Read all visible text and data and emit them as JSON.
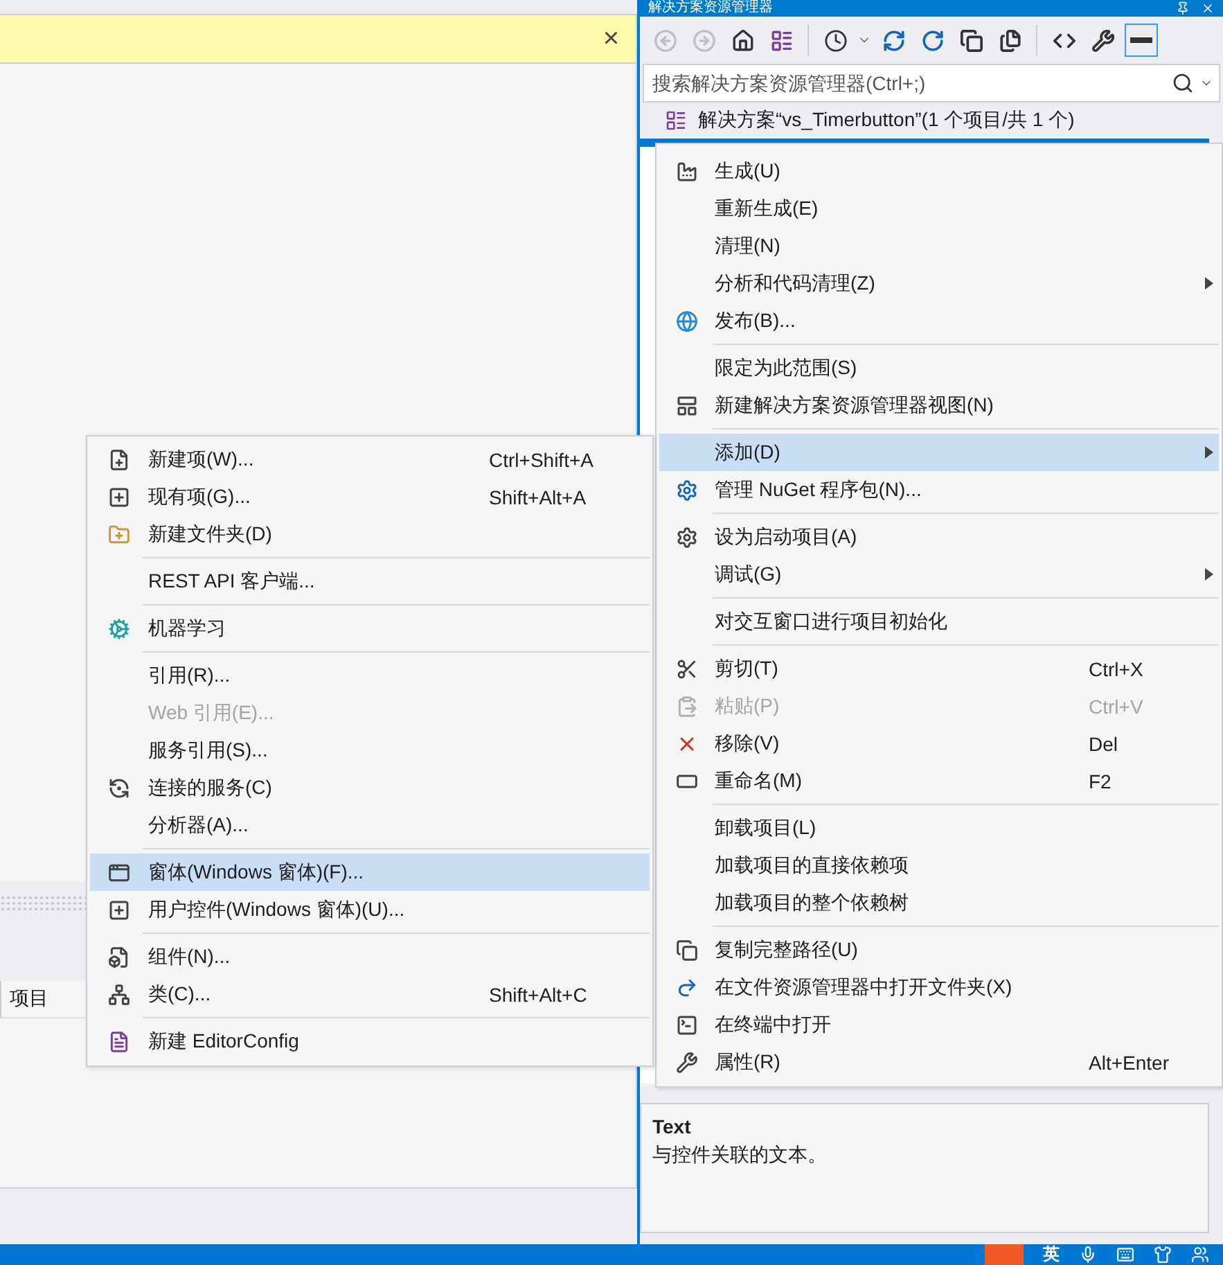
{
  "explorer": {
    "title": "解决方案资源管理器",
    "search": {
      "placeholder": "搜索解决方案资源管理器(Ctrl+;)"
    },
    "solution_row": {
      "label": "解决方案“vs_Timerbutton”(1 个项目/共 1 个)"
    }
  },
  "left_pane": {
    "info_bar": {
      "close": "×"
    },
    "column_header": "项目"
  },
  "properties": {
    "description_title": "Text",
    "description": "与控件关联的文本。"
  },
  "context_menu": {
    "items": [
      {
        "kind": "item",
        "label": "生成(U)",
        "selected": false,
        "disabled": false,
        "submenu": false
      },
      {
        "kind": "item",
        "label": "重新生成(E)",
        "selected": false,
        "disabled": false,
        "submenu": false
      },
      {
        "kind": "item",
        "label": "清理(N)",
        "selected": false,
        "disabled": false,
        "submenu": false
      },
      {
        "kind": "item",
        "label": "分析和代码清理(Z)",
        "selected": false,
        "disabled": false,
        "submenu": true
      },
      {
        "kind": "item",
        "label": "发布(B)...",
        "selected": false,
        "disabled": false,
        "submenu": false
      },
      {
        "kind": "separator"
      },
      {
        "kind": "item",
        "label": "限定为此范围(S)",
        "selected": false,
        "disabled": false,
        "submenu": false
      },
      {
        "kind": "item",
        "label": "新建解决方案资源管理器视图(N)",
        "selected": false,
        "disabled": false,
        "submenu": false
      },
      {
        "kind": "separator"
      },
      {
        "kind": "item",
        "label": "添加(D)",
        "selected": true,
        "disabled": false,
        "submenu": true
      },
      {
        "kind": "item",
        "label": "管理 NuGet 程序包(N)...",
        "selected": false,
        "disabled": false,
        "submenu": false
      },
      {
        "kind": "separator"
      },
      {
        "kind": "item",
        "label": "设为启动项目(A)",
        "selected": false,
        "disabled": false,
        "submenu": false
      },
      {
        "kind": "item",
        "label": "调试(G)",
        "selected": false,
        "disabled": false,
        "submenu": true
      },
      {
        "kind": "separator"
      },
      {
        "kind": "item",
        "label": "对交互窗口进行项目初始化",
        "selected": false,
        "disabled": false,
        "submenu": false
      },
      {
        "kind": "separator"
      },
      {
        "kind": "item",
        "label": "剪切(T)",
        "shortcut": "Ctrl+X",
        "selected": false,
        "disabled": false,
        "submenu": false
      },
      {
        "kind": "item",
        "label": "粘贴(P)",
        "shortcut": "Ctrl+V",
        "selected": false,
        "disabled": true,
        "submenu": false
      },
      {
        "kind": "item",
        "label": "移除(V)",
        "shortcut": "Del",
        "selected": false,
        "disabled": false,
        "submenu": false
      },
      {
        "kind": "item",
        "label": "重命名(M)",
        "shortcut": "F2",
        "selected": false,
        "disabled": false,
        "submenu": false
      },
      {
        "kind": "separator"
      },
      {
        "kind": "item",
        "label": "卸载项目(L)",
        "selected": false,
        "disabled": false,
        "submenu": false
      },
      {
        "kind": "item",
        "label": "加载项目的直接依赖项",
        "selected": false,
        "disabled": false,
        "submenu": false
      },
      {
        "kind": "item",
        "label": "加载项目的整个依赖树",
        "selected": false,
        "disabled": false,
        "submenu": false
      },
      {
        "kind": "separator"
      },
      {
        "kind": "item",
        "label": "复制完整路径(U)",
        "selected": false,
        "disabled": false,
        "submenu": false
      },
      {
        "kind": "item",
        "label": "在文件资源管理器中打开文件夹(X)",
        "selected": false,
        "disabled": false,
        "submenu": false
      },
      {
        "kind": "item",
        "label": "在终端中打开",
        "selected": false,
        "disabled": false,
        "submenu": false
      },
      {
        "kind": "item",
        "label": "属性(R)",
        "shortcut": "Alt+Enter",
        "selected": false,
        "disabled": false,
        "submenu": false
      }
    ]
  },
  "add_submenu": {
    "items": [
      {
        "kind": "item",
        "label": "新建项(W)...",
        "shortcut": "Ctrl+Shift+A",
        "selected": false,
        "disabled": false
      },
      {
        "kind": "item",
        "label": "现有项(G)...",
        "shortcut": "Shift+Alt+A",
        "selected": false,
        "disabled": false
      },
      {
        "kind": "item",
        "label": "新建文件夹(D)",
        "selected": false,
        "disabled": false
      },
      {
        "kind": "separator"
      },
      {
        "kind": "item",
        "label": "REST API 客户端...",
        "selected": false,
        "disabled": false
      },
      {
        "kind": "separator"
      },
      {
        "kind": "item",
        "label": "机器学习",
        "selected": false,
        "disabled": false
      },
      {
        "kind": "separator"
      },
      {
        "kind": "item",
        "label": "引用(R)...",
        "selected": false,
        "disabled": false
      },
      {
        "kind": "item",
        "label": "Web 引用(E)...",
        "selected": false,
        "disabled": true
      },
      {
        "kind": "item",
        "label": "服务引用(S)...",
        "selected": false,
        "disabled": false
      },
      {
        "kind": "item",
        "label": "连接的服务(C)",
        "selected": false,
        "disabled": false
      },
      {
        "kind": "item",
        "label": "分析器(A)...",
        "selected": false,
        "disabled": false
      },
      {
        "kind": "separator"
      },
      {
        "kind": "item",
        "label": "窗体(Windows 窗体)(F)...",
        "selected": true,
        "disabled": false
      },
      {
        "kind": "item",
        "label": "用户控件(Windows 窗体)(U)...",
        "selected": false,
        "disabled": false
      },
      {
        "kind": "separator"
      },
      {
        "kind": "item",
        "label": "组件(N)...",
        "selected": false,
        "disabled": false
      },
      {
        "kind": "item",
        "label": "类(C)...",
        "shortcut": "Shift+Alt+C",
        "selected": false,
        "disabled": false
      },
      {
        "kind": "separator"
      },
      {
        "kind": "item",
        "label": "新建 EditorConfig",
        "selected": false,
        "disabled": false
      }
    ]
  },
  "taskbar": {
    "ime": "英"
  }
}
